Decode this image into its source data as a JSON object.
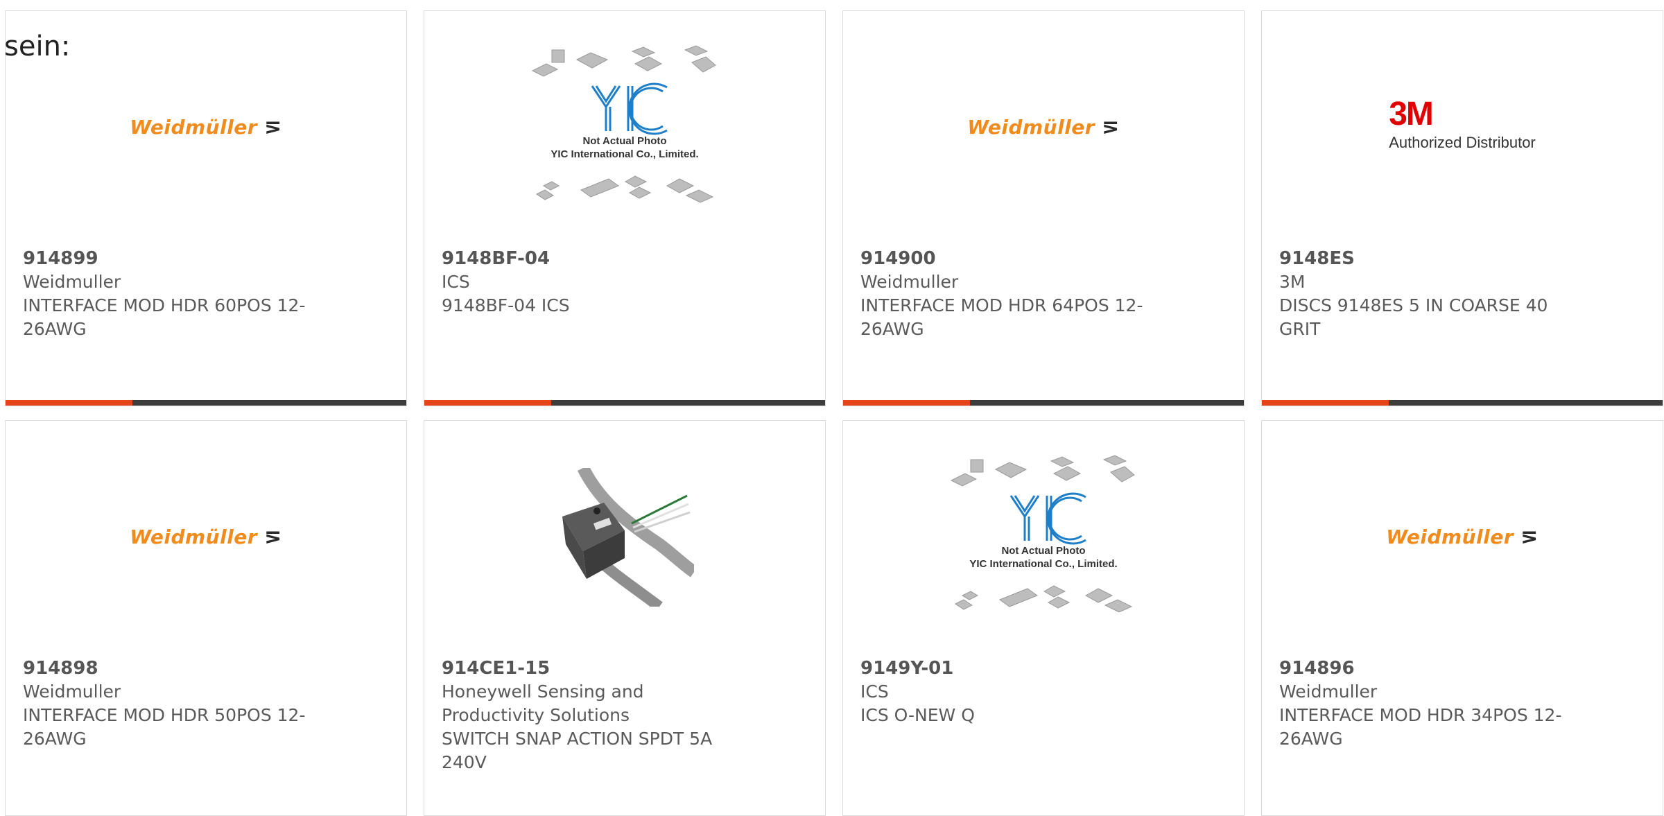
{
  "leading_text": "sein:",
  "logos": {
    "weidmuller": "Weidmüller",
    "threem_big": "3M",
    "threem_small": "Authorized Distributor",
    "yic_line1": "Not Actual Photo",
    "yic_line2": "YIC International Co., Limited."
  },
  "colors": {
    "accent": "#e8421a",
    "bar": "#3d3d3d",
    "weidmuller_orange": "#f08c1e",
    "threem_red": "#e00000",
    "yic_blue": "#1e7fc8"
  },
  "products": [
    {
      "part": "914899",
      "maker": "Weidmuller",
      "desc": "INTERFACE MOD HDR 60POS 12-26AWG",
      "image": "weidmuller-logo"
    },
    {
      "part": "9148BF-04",
      "maker": "ICS",
      "desc": "9148BF-04 ICS",
      "image": "yic-placeholder"
    },
    {
      "part": "914900",
      "maker": "Weidmuller",
      "desc": "INTERFACE MOD HDR 64POS 12-26AWG",
      "image": "weidmuller-logo"
    },
    {
      "part": "9148ES",
      "maker": "3M",
      "desc": "DISCS 9148ES 5 IN COARSE 40 GRIT",
      "image": "3m-logo"
    },
    {
      "part": "914898",
      "maker": "Weidmuller",
      "desc": "INTERFACE MOD HDR 50POS 12-26AWG",
      "image": "weidmuller-logo"
    },
    {
      "part": "914CE1-15",
      "maker": "Honeywell Sensing and Productivity Solutions",
      "desc": "SWITCH SNAP ACTION SPDT 5A 240V",
      "image": "switch-photo"
    },
    {
      "part": "9149Y-01",
      "maker": "ICS",
      "desc": "ICS O-NEW Q",
      "image": "yic-placeholder"
    },
    {
      "part": "914896",
      "maker": "Weidmuller",
      "desc": "INTERFACE MOD HDR 34POS 12-26AWG",
      "image": "weidmuller-logo"
    }
  ]
}
